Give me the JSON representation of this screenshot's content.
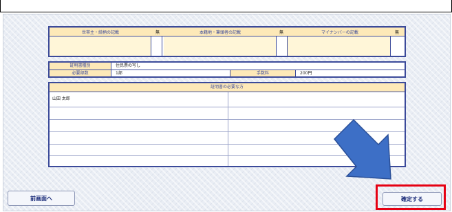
{
  "declaration": {
    "col1": "世帯主・続柄の記載",
    "col2": "本籍地・筆頭者の記載",
    "col3": "マイナンバーの記載",
    "check_header": "無"
  },
  "certificate": {
    "type_label": "証明書種別",
    "type_value": "住民票の写し",
    "count_label": "必要部数",
    "count_value": "1部",
    "fee_label": "手数料",
    "fee_value": "200円"
  },
  "persons": {
    "header": "証明書の必要な方",
    "rows": [
      "山田 太郎",
      "",
      "",
      "",
      "",
      ""
    ]
  },
  "buttons": {
    "back": "前画面へ",
    "confirm": "確定する"
  },
  "colors": {
    "accent": "#3b4a9a",
    "header_bg": "#fde9b8",
    "highlight_frame": "#e60012",
    "arrow": "#3d6fc6"
  },
  "icons": {
    "arrow": "arrow-down-right-icon"
  }
}
